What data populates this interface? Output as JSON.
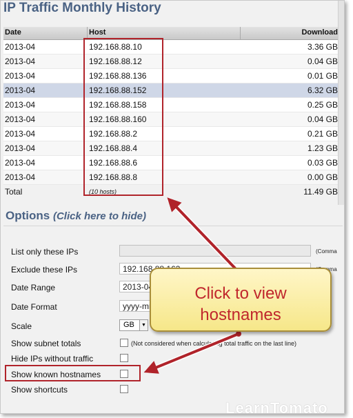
{
  "page": {
    "title": "IP Traffic Monthly History"
  },
  "table": {
    "headers": {
      "date": "Date",
      "host": "Host",
      "download": "Download"
    },
    "rows": [
      {
        "date": "2013-04",
        "host": "192.168.88.10",
        "download": "3.36 GB"
      },
      {
        "date": "2013-04",
        "host": "192.168.88.12",
        "download": "0.04 GB"
      },
      {
        "date": "2013-04",
        "host": "192.168.88.136",
        "download": "0.01 GB"
      },
      {
        "date": "2013-04",
        "host": "192.168.88.152",
        "download": "6.32 GB"
      },
      {
        "date": "2013-04",
        "host": "192.168.88.158",
        "download": "0.25 GB"
      },
      {
        "date": "2013-04",
        "host": "192.168.88.160",
        "download": "0.04 GB"
      },
      {
        "date": "2013-04",
        "host": "192.168.88.2",
        "download": "0.21 GB"
      },
      {
        "date": "2013-04",
        "host": "192.168.88.4",
        "download": "1.23 GB"
      },
      {
        "date": "2013-04",
        "host": "192.168.88.6",
        "download": "0.03 GB"
      },
      {
        "date": "2013-04",
        "host": "192.168.88.8",
        "download": "0.00 GB"
      }
    ],
    "total": {
      "label": "Total",
      "hosts": "(10 hosts)",
      "download": "11.49 GB"
    }
  },
  "options": {
    "title": "Options",
    "toggle": "(Click here to hide)",
    "list_only_label": "List only these IPs",
    "list_only_value": "",
    "list_only_note": "(Comma",
    "exclude_label": "Exclude these IPs",
    "exclude_value": "192.168.88.163",
    "exclude_note": "(Comma",
    "date_range_label": "Date Range",
    "date_range_value": "2013-04",
    "date_format_label": "Date Format",
    "date_format_value": "yyyy-mm",
    "scale_label": "Scale",
    "scale_value": "GB",
    "subnet_label": "Show subnet totals",
    "subnet_note": "(Not considered when calculating total traffic on the last line)",
    "hide_ips_label": "Hide IPs without traffic",
    "known_hostnames_label": "Show known hostnames",
    "shortcuts_label": "Show shortcuts"
  },
  "callout": {
    "line1": "Click to view",
    "line2": "hostnames"
  },
  "watermark": "LearnTomato",
  "colors": {
    "accent": "#4a6284",
    "annotation": "#b0232a",
    "selected_row": "#cfd7e7"
  }
}
